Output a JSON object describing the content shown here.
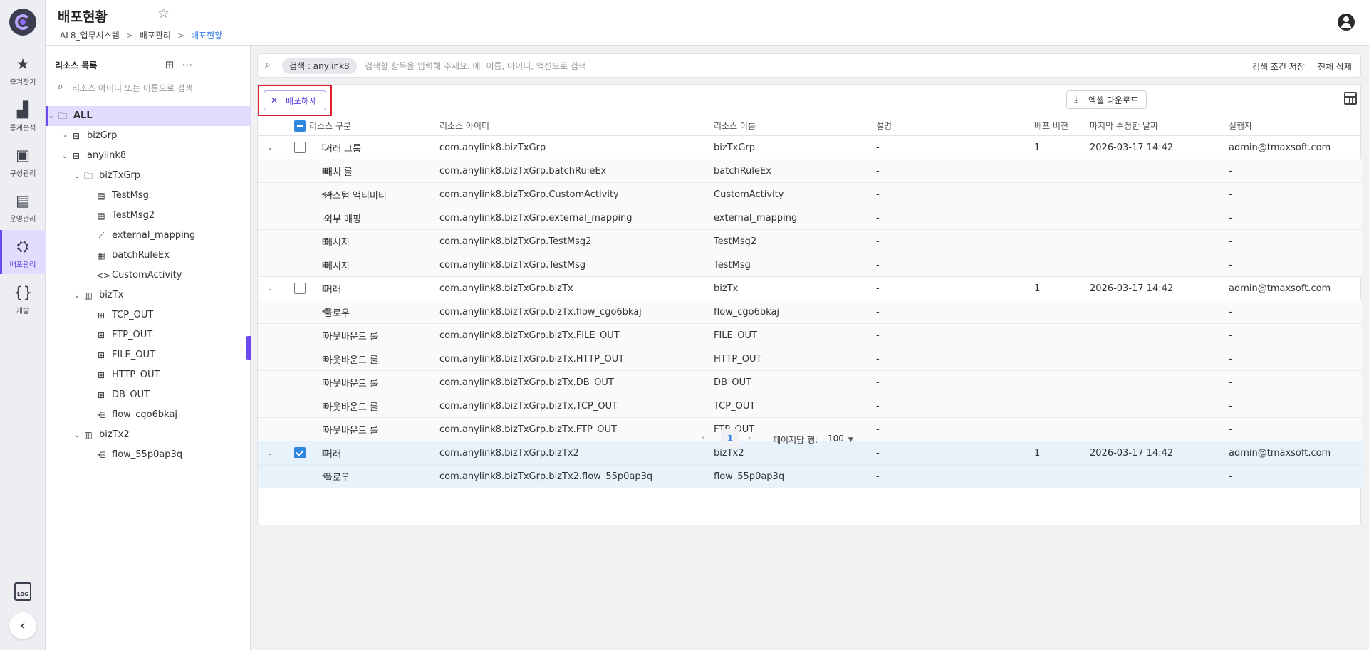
{
  "nav": {
    "items": [
      {
        "label": "즐겨찾기",
        "icon": "★"
      },
      {
        "label": "통계분석",
        "icon": "▟"
      },
      {
        "label": "구성관리",
        "icon": "▣"
      },
      {
        "label": "운영관리",
        "icon": "▤"
      },
      {
        "label": "배포관리",
        "icon": "⛭"
      },
      {
        "label": "개발",
        "icon": "{}"
      }
    ],
    "active": "배포관리",
    "log_icon": "LOG"
  },
  "header": {
    "title": "배포현황",
    "breadcrumb": [
      "AL8_업무시스템",
      "배포관리",
      "배포현황"
    ]
  },
  "resource_panel": {
    "title": "리소스 목록",
    "search_placeholder": "리소스 아이디 또는 이름으로 검색",
    "tree": [
      {
        "label": "ALL",
        "depth": 0,
        "expanded": true,
        "icon": "folder-icon",
        "glyph": "🗀"
      },
      {
        "label": "bizGrp",
        "depth": 1,
        "expanded": false,
        "icon": "briefcase-icon",
        "glyph": "⊟"
      },
      {
        "label": "anylink8",
        "depth": 1,
        "expanded": true,
        "icon": "briefcase-icon",
        "glyph": "⊟"
      },
      {
        "label": "bizTxGrp",
        "depth": 2,
        "expanded": true,
        "icon": "folder-icon",
        "glyph": "🗀"
      },
      {
        "label": "TestMsg",
        "depth": 3,
        "icon": "message-icon",
        "glyph": "▤"
      },
      {
        "label": "TestMsg2",
        "depth": 3,
        "icon": "message-icon",
        "glyph": "▤"
      },
      {
        "label": "external_mapping",
        "depth": 3,
        "icon": "mapping-icon",
        "glyph": "⟋"
      },
      {
        "label": "batchRuleEx",
        "depth": 3,
        "icon": "batch-icon",
        "glyph": "▦"
      },
      {
        "label": "CustomActivity",
        "depth": 3,
        "icon": "code-icon",
        "glyph": "<>"
      },
      {
        "label": "bizTx",
        "depth": 2,
        "expanded": true,
        "icon": "transaction-icon",
        "glyph": "▥"
      },
      {
        "label": "TCP_OUT",
        "depth": 3,
        "icon": "outbound-rule-icon",
        "glyph": "⊞"
      },
      {
        "label": "FTP_OUT",
        "depth": 3,
        "icon": "outbound-rule-icon",
        "glyph": "⊞"
      },
      {
        "label": "FILE_OUT",
        "depth": 3,
        "icon": "outbound-rule-icon",
        "glyph": "⊞"
      },
      {
        "label": "HTTP_OUT",
        "depth": 3,
        "icon": "outbound-rule-icon",
        "glyph": "⊞"
      },
      {
        "label": "DB_OUT",
        "depth": 3,
        "icon": "outbound-rule-icon",
        "glyph": "⊞"
      },
      {
        "label": "flow_cgo6bkaj",
        "depth": 3,
        "icon": "flow-icon",
        "glyph": "⋲"
      },
      {
        "label": "bizTx2",
        "depth": 2,
        "expanded": true,
        "icon": "transaction-icon",
        "glyph": "▥"
      },
      {
        "label": "flow_55p0ap3q",
        "depth": 3,
        "icon": "flow-icon",
        "glyph": "⋲"
      }
    ]
  },
  "search": {
    "chip": "검색 : anylink8",
    "placeholder": "검색할 항목을 입력해 주세요. 예: 이름, 아이디, 액션으로 검색",
    "save_label": "검색 조건 저장",
    "clear_label": "전체 삭제"
  },
  "toolbar": {
    "undeploy_label": "배포해제",
    "excel_label": "엑셀 다운로드"
  },
  "table": {
    "columns": [
      "리소스 구분",
      "리소스 아이디",
      "리소스 이름",
      "설명",
      "배포 버전",
      "마지막 수정한 날짜",
      "실행자"
    ],
    "rows": [
      {
        "type": "거래 그룹",
        "icon": "folder-icon",
        "glyph": "🗀",
        "id": "com.anylink8.bizTxGrp",
        "name": "bizTxGrp",
        "desc": "-",
        "version": "1",
        "modified": "2026-03-17 14:42",
        "executor": "admin@tmaxsoft.com",
        "parent": true,
        "checked": false
      },
      {
        "type": "배치 룰",
        "icon": "batch-icon",
        "glyph": "▦",
        "id": "com.anylink8.bizTxGrp.batchRuleEx",
        "name": "batchRuleEx",
        "desc": "-",
        "version": "",
        "modified": "",
        "executor": "-",
        "parent": false,
        "checked": false
      },
      {
        "type": "커스텀 액티비티",
        "icon": "code-icon",
        "glyph": "<>",
        "id": "com.anylink8.bizTxGrp.CustomActivity",
        "name": "CustomActivity",
        "desc": "-",
        "version": "",
        "modified": "",
        "executor": "-",
        "parent": false,
        "checked": false
      },
      {
        "type": "외부 매핑",
        "icon": "mapping-icon",
        "glyph": "⟋",
        "id": "com.anylink8.bizTxGrp.external_mapping",
        "name": "external_mapping",
        "desc": "-",
        "version": "",
        "modified": "",
        "executor": "-",
        "parent": false,
        "checked": false
      },
      {
        "type": "메시지",
        "icon": "message-icon",
        "glyph": "▤",
        "id": "com.anylink8.bizTxGrp.TestMsg2",
        "name": "TestMsg2",
        "desc": "-",
        "version": "",
        "modified": "",
        "executor": "-",
        "parent": false,
        "checked": false
      },
      {
        "type": "메시지",
        "icon": "message-icon",
        "glyph": "▤",
        "id": "com.anylink8.bizTxGrp.TestMsg",
        "name": "TestMsg",
        "desc": "-",
        "version": "",
        "modified": "",
        "executor": "-",
        "parent": false,
        "checked": false
      },
      {
        "type": "거래",
        "icon": "transaction-icon",
        "glyph": "▥",
        "id": "com.anylink8.bizTxGrp.bizTx",
        "name": "bizTx",
        "desc": "-",
        "version": "1",
        "modified": "2026-03-17 14:42",
        "executor": "admin@tmaxsoft.com",
        "parent": true,
        "checked": false
      },
      {
        "type": "플로우",
        "icon": "flow-icon",
        "glyph": "⋲",
        "id": "com.anylink8.bizTxGrp.bizTx.flow_cgo6bkaj",
        "name": "flow_cgo6bkaj",
        "desc": "-",
        "version": "",
        "modified": "",
        "executor": "-",
        "parent": false,
        "checked": false
      },
      {
        "type": "아웃바운드 룰",
        "icon": "outbound-rule-icon",
        "glyph": "⊞",
        "id": "com.anylink8.bizTxGrp.bizTx.FILE_OUT",
        "name": "FILE_OUT",
        "desc": "-",
        "version": "",
        "modified": "",
        "executor": "-",
        "parent": false,
        "checked": false
      },
      {
        "type": "아웃바운드 룰",
        "icon": "outbound-rule-icon",
        "glyph": "⊞",
        "id": "com.anylink8.bizTxGrp.bizTx.HTTP_OUT",
        "name": "HTTP_OUT",
        "desc": "-",
        "version": "",
        "modified": "",
        "executor": "-",
        "parent": false,
        "checked": false
      },
      {
        "type": "아웃바운드 룰",
        "icon": "outbound-rule-icon",
        "glyph": "⊞",
        "id": "com.anylink8.bizTxGrp.bizTx.DB_OUT",
        "name": "DB_OUT",
        "desc": "-",
        "version": "",
        "modified": "",
        "executor": "-",
        "parent": false,
        "checked": false
      },
      {
        "type": "아웃바운드 룰",
        "icon": "outbound-rule-icon",
        "glyph": "⊞",
        "id": "com.anylink8.bizTxGrp.bizTx.TCP_OUT",
        "name": "TCP_OUT",
        "desc": "-",
        "version": "",
        "modified": "",
        "executor": "-",
        "parent": false,
        "checked": false
      },
      {
        "type": "아웃바운드 룰",
        "icon": "outbound-rule-icon",
        "glyph": "⊞",
        "id": "com.anylink8.bizTxGrp.bizTx.FTP_OUT",
        "name": "FTP_OUT",
        "desc": "-",
        "version": "",
        "modified": "",
        "executor": "-",
        "parent": false,
        "checked": false
      },
      {
        "type": "거래",
        "icon": "transaction-icon",
        "glyph": "▥",
        "id": "com.anylink8.bizTxGrp.bizTx2",
        "name": "bizTx2",
        "desc": "-",
        "version": "1",
        "modified": "2026-03-17 14:42",
        "executor": "admin@tmaxsoft.com",
        "parent": true,
        "checked": true
      },
      {
        "type": "플로우",
        "icon": "flow-icon",
        "glyph": "⋲",
        "id": "com.anylink8.bizTxGrp.bizTx2.flow_55p0ap3q",
        "name": "flow_55p0ap3q",
        "desc": "-",
        "version": "",
        "modified": "",
        "executor": "-",
        "parent": false,
        "checked": true
      }
    ]
  },
  "pagination": {
    "page": "1",
    "rows_label": "페이지당 행:",
    "rows_value": "100"
  },
  "colors": {
    "accent": "#6c48f0",
    "link": "#2f7ae5",
    "checkbox": "#2f87e0",
    "highlight": "#e0202a"
  }
}
